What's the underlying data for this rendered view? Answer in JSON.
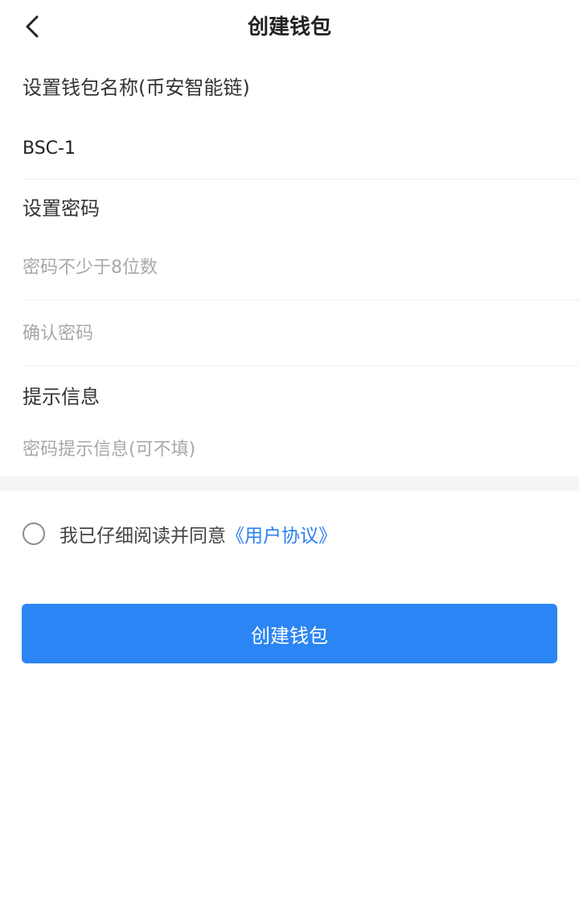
{
  "header": {
    "title": "创建钱包",
    "back_icon": "chevron-left-icon"
  },
  "form": {
    "wallet_name_label": "设置钱包名称(币安智能链)",
    "wallet_name_value": "BSC-1",
    "password_label": "设置密码",
    "password_placeholder": "密码不少于8位数",
    "confirm_password_placeholder": "确认密码",
    "hint_label": "提示信息",
    "hint_placeholder": "密码提示信息(可不填)"
  },
  "agreement": {
    "text": "我已仔细阅读并同意",
    "link": "《用户协议》",
    "checked": false
  },
  "actions": {
    "create_label": "创建钱包"
  },
  "colors": {
    "accent": "#2b85f4",
    "link": "#2b7ff0",
    "placeholder": "#a8a8a8"
  }
}
